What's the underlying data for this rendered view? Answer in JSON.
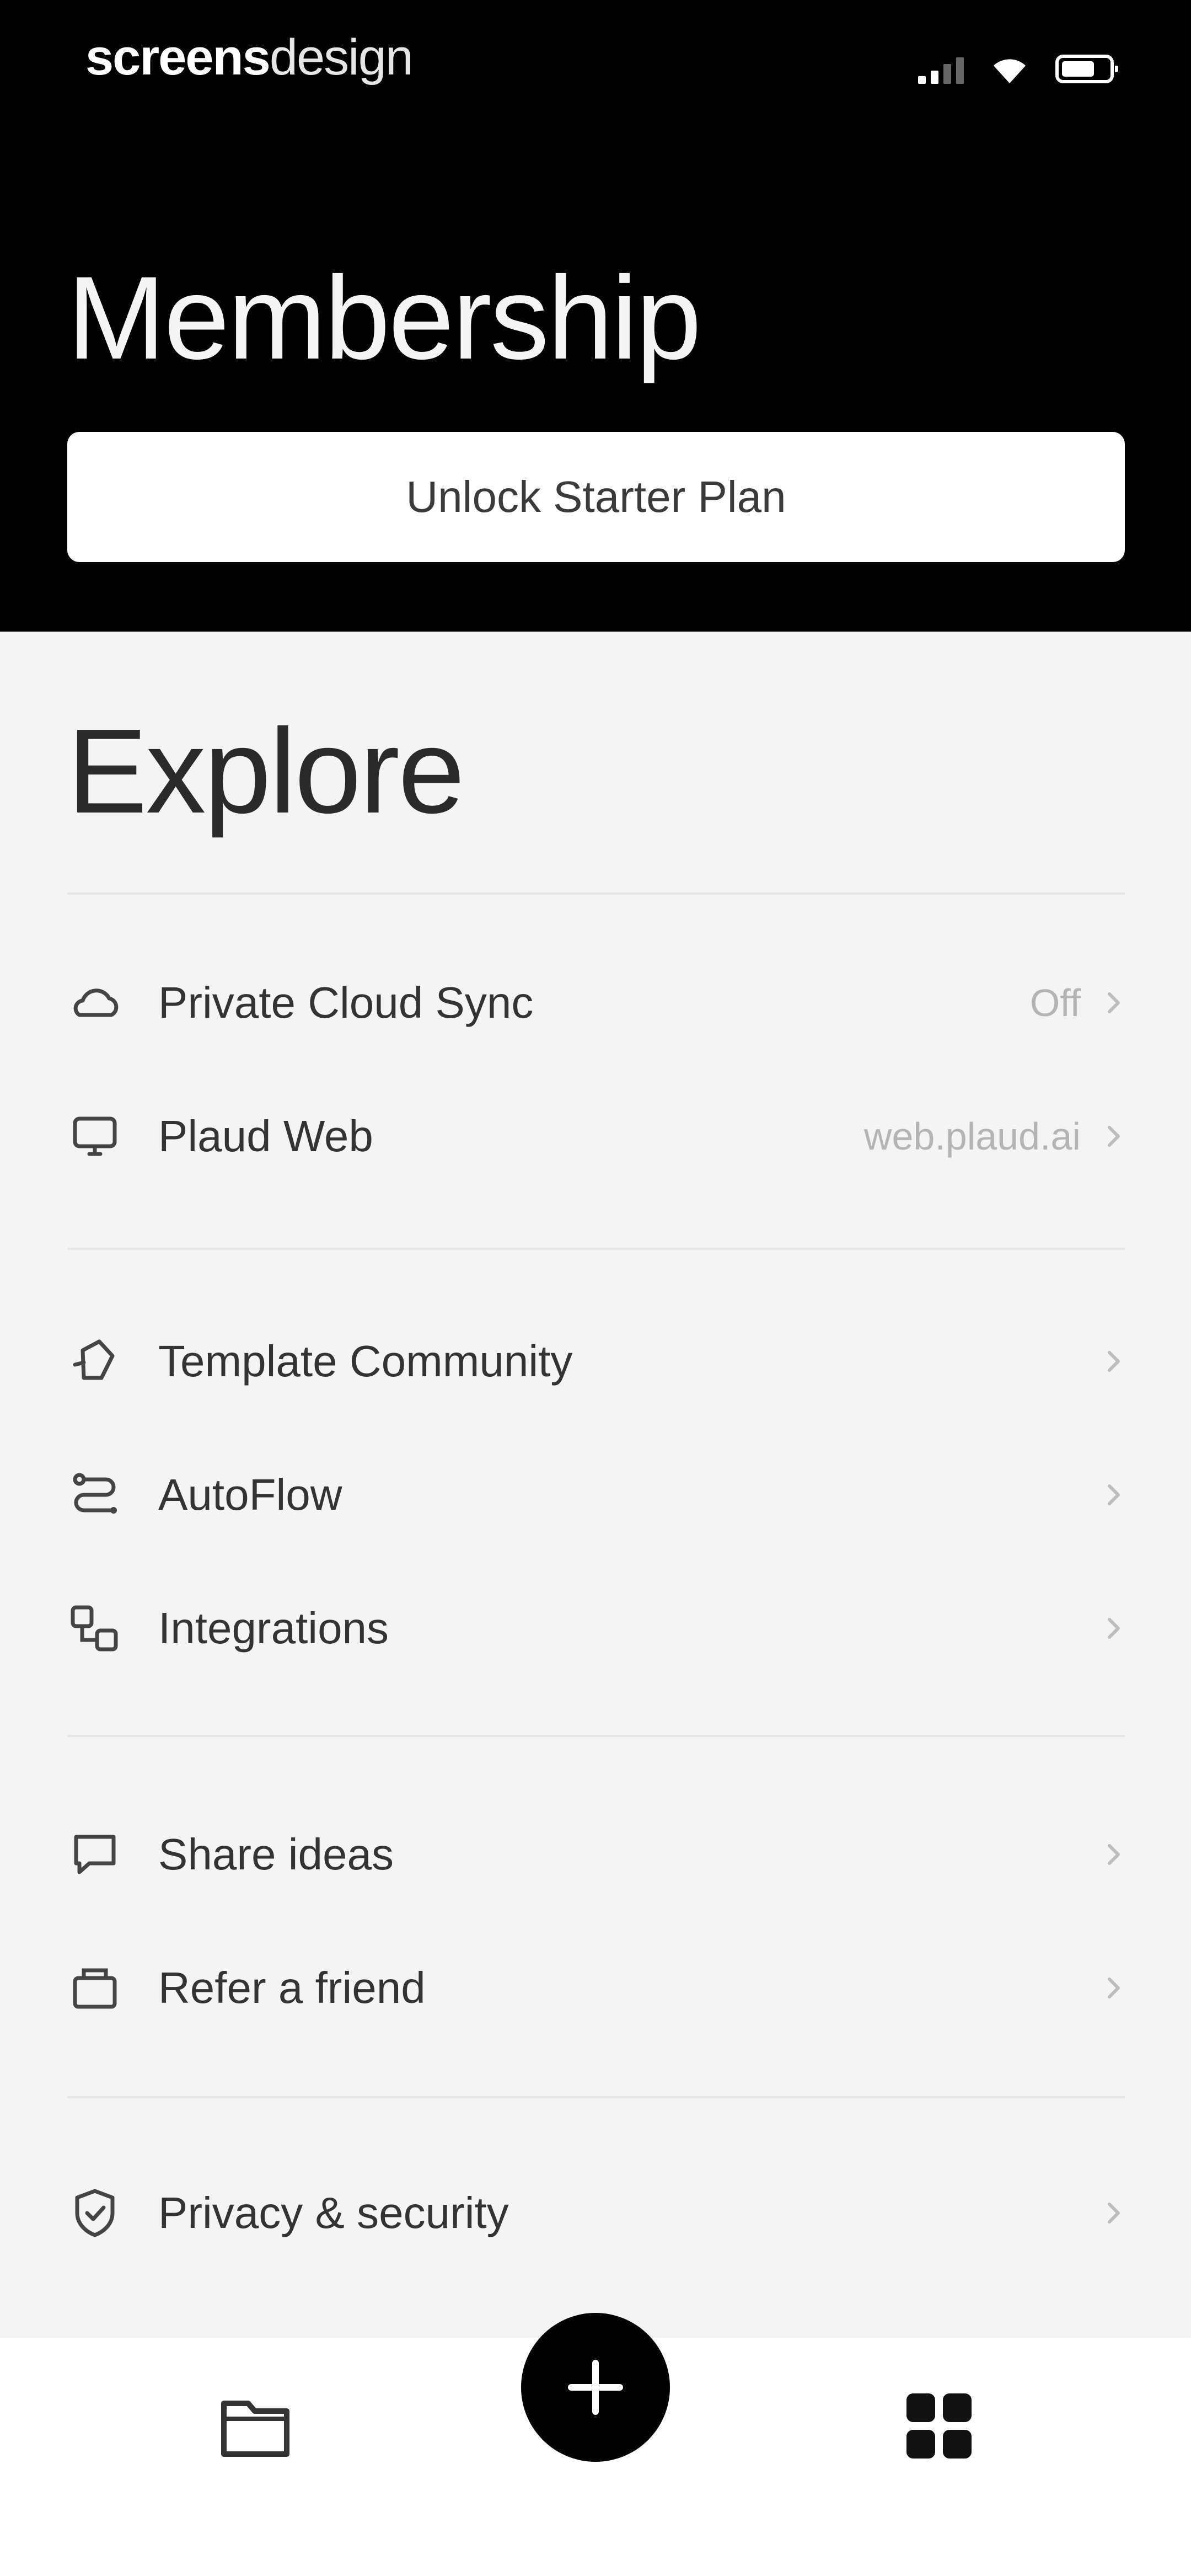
{
  "status_bar": {
    "brand_bold": "screens",
    "brand_light": "design"
  },
  "header": {
    "title": "Membership",
    "unlock_label": "Unlock Starter Plan"
  },
  "explore": {
    "title": "Explore",
    "groups": [
      [
        {
          "icon": "cloud-icon",
          "label": "Private Cloud Sync",
          "value": "Off"
        },
        {
          "icon": "monitor-icon",
          "label": "Plaud Web",
          "value": "web.plaud.ai"
        }
      ],
      [
        {
          "icon": "template-icon",
          "label": "Template Community",
          "value": ""
        },
        {
          "icon": "autoflow-icon",
          "label": "AutoFlow",
          "value": ""
        },
        {
          "icon": "integrations-icon",
          "label": "Integrations",
          "value": ""
        }
      ],
      [
        {
          "icon": "message-icon",
          "label": "Share ideas",
          "value": ""
        },
        {
          "icon": "gift-icon",
          "label": "Refer a friend",
          "value": ""
        }
      ],
      [
        {
          "icon": "shield-icon",
          "label": "Privacy & security",
          "value": ""
        }
      ]
    ]
  },
  "bottom_nav": {
    "left_icon": "folder-icon",
    "center_icon": "plus-icon",
    "right_icon": "apps-grid-icon"
  }
}
